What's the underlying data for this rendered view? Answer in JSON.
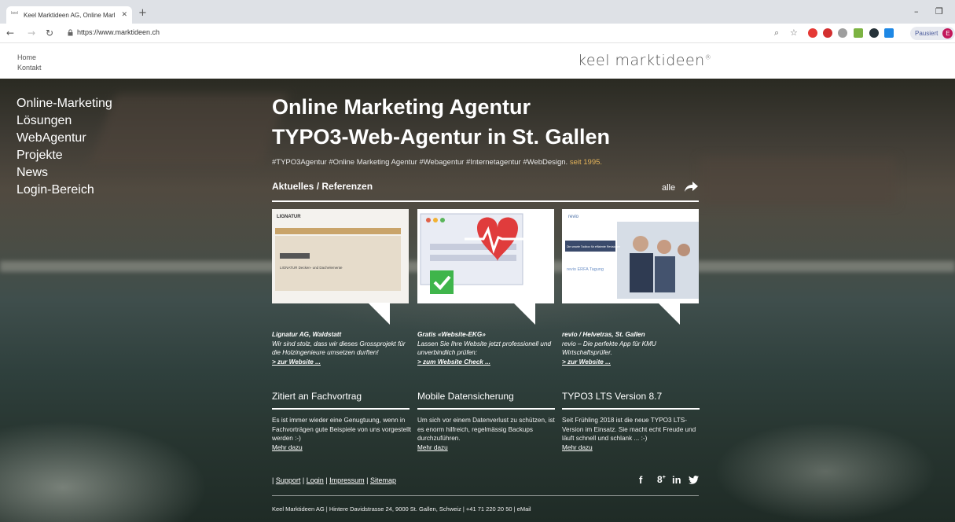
{
  "browser": {
    "tab_title": "Keel Marktideen AG, Online Marl",
    "tab_favicon_text": "keel",
    "url": "https://www.marktideen.ch",
    "profile_status": "Pausiert",
    "profile_initial": "E"
  },
  "header": {
    "links": [
      "Home",
      "Kontakt"
    ],
    "brand": "keel marktideen",
    "brand_mark": "®"
  },
  "sidenav": [
    "Online-Marketing",
    "Lösungen",
    "WebAgentur",
    "Projekte",
    "News",
    "Login-Bereich"
  ],
  "hero": {
    "title_line1": "Online Marketing Agentur",
    "title_line2": "TYPO3-Web-Agentur in St. Gallen",
    "tags": "#TYPO3Agentur #Online Marketing Agentur #Webagentur #Internetagentur #WebDesign.",
    "since": " seit 1995."
  },
  "news": {
    "section_title": "Aktuelles / Referenzen",
    "all_label": "alle",
    "cards": [
      {
        "thumb_label": "LIGNATUR",
        "thumb_caption": "LIGNATUR Decken- und Dachelemente",
        "heading": "Lignatur AG, Waldstatt",
        "text": "Wir sind stolz, dass wir dieses Grossprojekt für die Holzingenieure umsetzen durften!",
        "link": "> zur Website ..."
      },
      {
        "heading": "Gratis «Website-EKG»",
        "text": "Lassen Sie Ihre Website jetzt professionell und unverbindlich prüfen:",
        "link": "> zum Website Check ..."
      },
      {
        "thumb_label": "revio",
        "thumb_caption": "Die smarte Toolbox für effiziente Revisionen",
        "thumb_event": "revio ERFA Tagung",
        "heading": "revio / Helvetras, St. Gallen",
        "text": "revio – Die perfekte App für KMU Wirtschaftsprüfer.",
        "link": "> zur Website ..."
      }
    ]
  },
  "columns": [
    {
      "title": "Zitiert an Fachvortrag",
      "text": "Es ist immer wieder eine Genugtuung, wenn in Fachvorträgen gute Beispiele von uns vorgestellt werden :-)",
      "link": "Mehr dazu"
    },
    {
      "title": "Mobile Datensicherung",
      "text": "Um sich vor einem Datenverlust zu schützen, ist es enorm hilfreich, regelmässig Backups durchzuführen.",
      "link": "Mehr dazu"
    },
    {
      "title": "TYPO3 LTS Version 8.7",
      "text": "Seit Frühling 2018 ist die neue TYPO3 LTS-Version im Einsatz. Sie macht echt Freude und läuft schnell und schlank ... :-)",
      "link": "Mehr dazu"
    }
  ],
  "footer": {
    "links": [
      "Support",
      "Login",
      "Impressum",
      "Sitemap"
    ],
    "social": [
      "f",
      "g+",
      "in",
      "twitter"
    ],
    "address": "Keel Marktideen AG | Hintere Davidstrasse 24, 9000 St. Gallen, Schweiz | +41 71 220 20 50 | eMail"
  },
  "colors": {
    "accent_since": "#e3b35a",
    "ekg_heart": "#e03c3c",
    "ekg_check": "#3fb54b"
  }
}
